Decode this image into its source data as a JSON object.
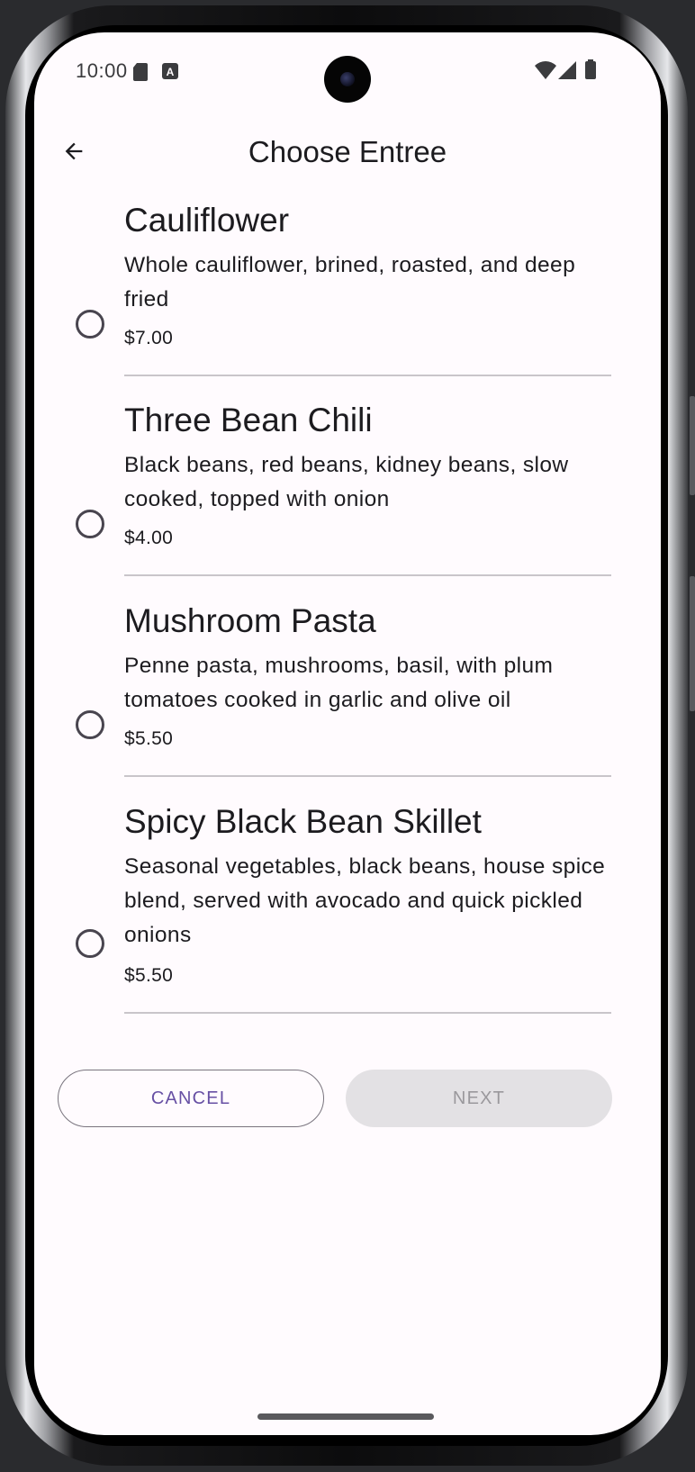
{
  "status_bar": {
    "time": "10:00",
    "icons": [
      "sd-card-icon",
      "a-badge-icon",
      "wifi-icon",
      "signal-icon",
      "battery-icon"
    ]
  },
  "top_bar": {
    "title": "Choose Entree",
    "back_icon": "arrow-back-icon"
  },
  "entrees": [
    {
      "name": "Cauliflower",
      "description": "Whole cauliflower, brined, roasted, and deep fried",
      "price": "$7.00",
      "selected": false
    },
    {
      "name": "Three Bean Chili",
      "description": "Black beans, red beans, kidney beans, slow cooked, topped with onion",
      "price": "$4.00",
      "selected": false
    },
    {
      "name": "Mushroom Pasta",
      "description": "Penne pasta, mushrooms, basil, with plum tomatoes cooked in garlic and olive oil",
      "price": "$5.50",
      "selected": false
    },
    {
      "name": "Spicy Black Bean Skillet",
      "description": "Seasonal vegetables, black beans, house spice blend, served with avocado and quick pickled onions",
      "price": "$5.50",
      "selected": false
    }
  ],
  "actions": {
    "cancel_label": "CANCEL",
    "next_label": "NEXT",
    "next_enabled": false
  },
  "colors": {
    "primary": "#6750a4",
    "surface": "#fffbfe",
    "on_surface": "#1c1b1f",
    "disabled_container": "#e3e1e4",
    "disabled_text": "#9a989c",
    "outline": "#79747e"
  }
}
